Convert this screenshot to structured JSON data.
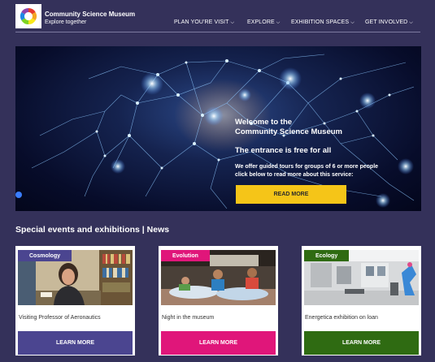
{
  "header": {
    "logo_title": "Community Science Museum",
    "logo_subtitle": "Explore together",
    "nav": [
      {
        "label": "PLAN YOU'RE VISIT"
      },
      {
        "label": "EXPLORE"
      },
      {
        "label": "EXHIBITION SPACES"
      },
      {
        "label": "GET INVOLVED"
      }
    ]
  },
  "hero": {
    "title_line1": "Welcome to the",
    "title_line2": "Community Science Museum",
    "free_text": "The entrance is free for all",
    "desc_line1": "We offer guided tours for groups of 6 or more people",
    "desc_line2": "click below to read more about this service:",
    "button_label": "READ MORE",
    "button_color": "#f5c518"
  },
  "section": {
    "title": "Special events and exhibitions | News"
  },
  "cards": [
    {
      "tag": "Cosmology",
      "caption": "Visiting Professor of Aeronautics",
      "button": "LEARN MORE",
      "color": "#4b4590"
    },
    {
      "tag": "Evolution",
      "caption": "Night in the museum",
      "button": "LEARN MORE",
      "color": "#e0167a"
    },
    {
      "tag": "Ecology",
      "caption": "Energetica exhibition on loan",
      "button": "LEARN MORE",
      "color": "#2f6b12"
    }
  ],
  "colors": {
    "background": "#34315a"
  }
}
